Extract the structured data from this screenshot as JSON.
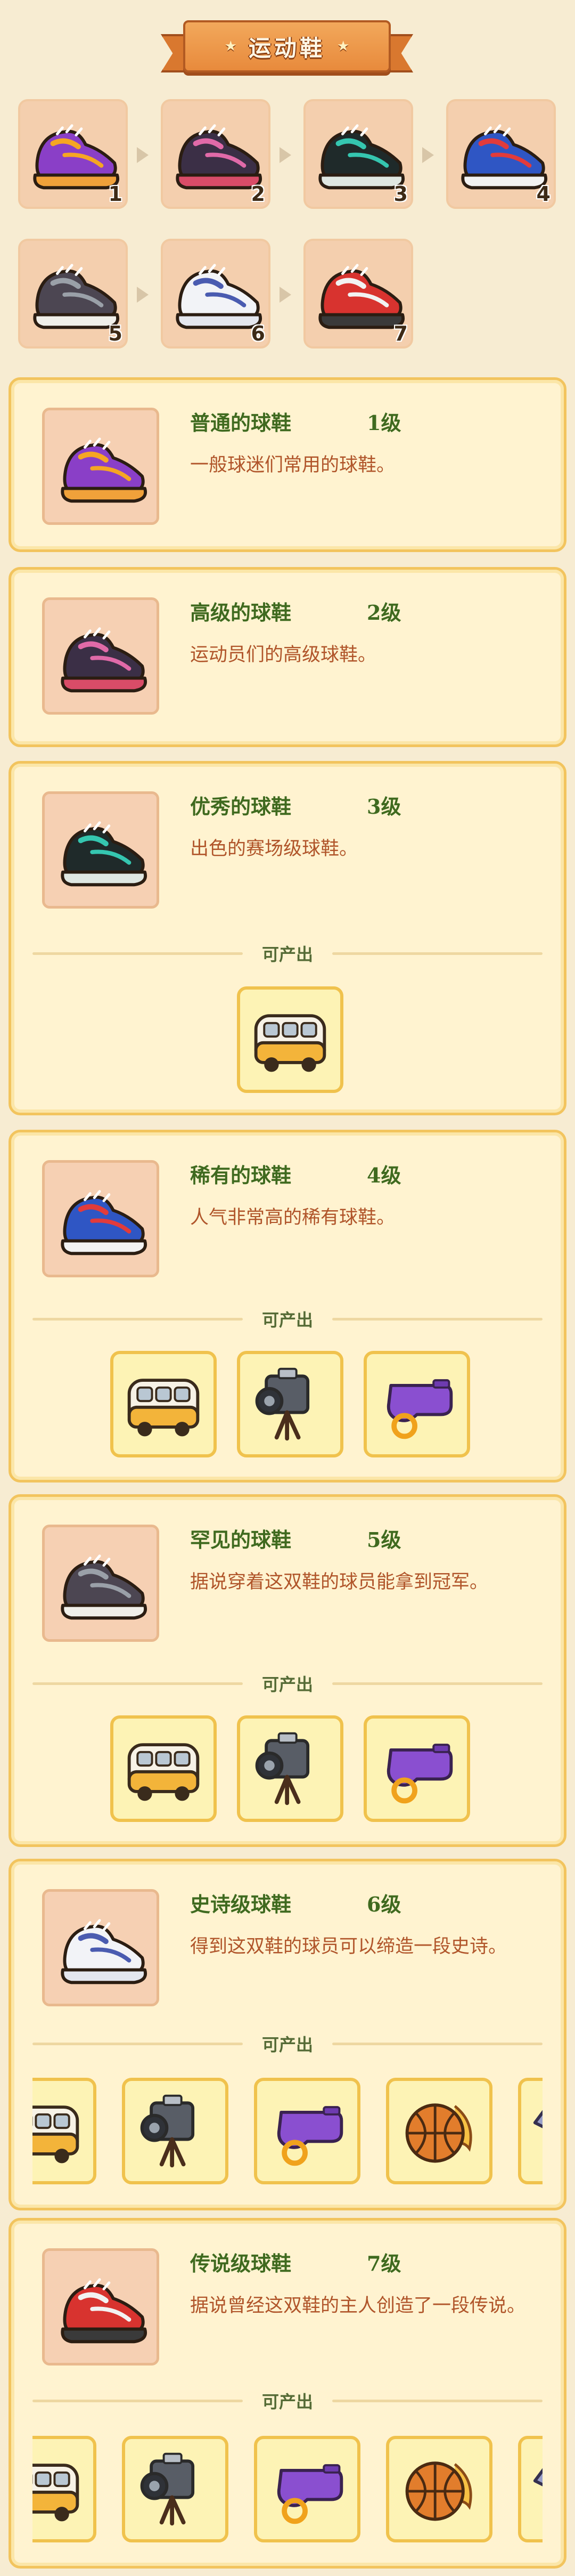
{
  "header": {
    "title": "运动鞋",
    "star": "★"
  },
  "evolution": {
    "numbers": [
      "1",
      "2",
      "3",
      "4",
      "5",
      "6",
      "7"
    ]
  },
  "cards": [
    {
      "name": "普通的球鞋",
      "level": "1级",
      "desc": "一般球迷们常用的球鞋。",
      "produce_label": "",
      "items": []
    },
    {
      "name": "高级的球鞋",
      "level": "2级",
      "desc": "运动员们的高级球鞋。",
      "produce_label": "",
      "items": []
    },
    {
      "name": "优秀的球鞋",
      "level": "3级",
      "desc": "出色的赛场级球鞋。",
      "produce_label": "可产出",
      "items": [
        "bus"
      ]
    },
    {
      "name": "稀有的球鞋",
      "level": "4级",
      "desc": "人气非常高的稀有球鞋。",
      "produce_label": "可产出",
      "items": [
        "bus",
        "camera",
        "whistle"
      ]
    },
    {
      "name": "罕见的球鞋",
      "level": "5级",
      "desc": "据说穿着这双鞋的球员能拿到冠军。",
      "produce_label": "可产出",
      "items": [
        "bus",
        "camera",
        "whistle"
      ]
    },
    {
      "name": "史诗级球鞋",
      "level": "6级",
      "desc": "得到这双鞋的球员可以缔造一段史诗。",
      "produce_label": "可产出",
      "items": [
        "bus",
        "camera",
        "whistle",
        "basketball",
        "jersey"
      ]
    },
    {
      "name": "传说级球鞋",
      "level": "7级",
      "desc": "据说曾经这双鞋的主人创造了一段传说。",
      "produce_label": "可产出",
      "items": [
        "bus",
        "camera",
        "whistle",
        "basketball",
        "jersey"
      ]
    }
  ],
  "colors": {
    "shoe1": "#8a3fc7",
    "shoe2": "#3b2f46",
    "shoe3": "#1f2a2a",
    "shoe4": "#2f56c4",
    "shoe5": "#4c4652",
    "shoe6": "#f2f3f7",
    "shoe7": "#d8332f"
  }
}
